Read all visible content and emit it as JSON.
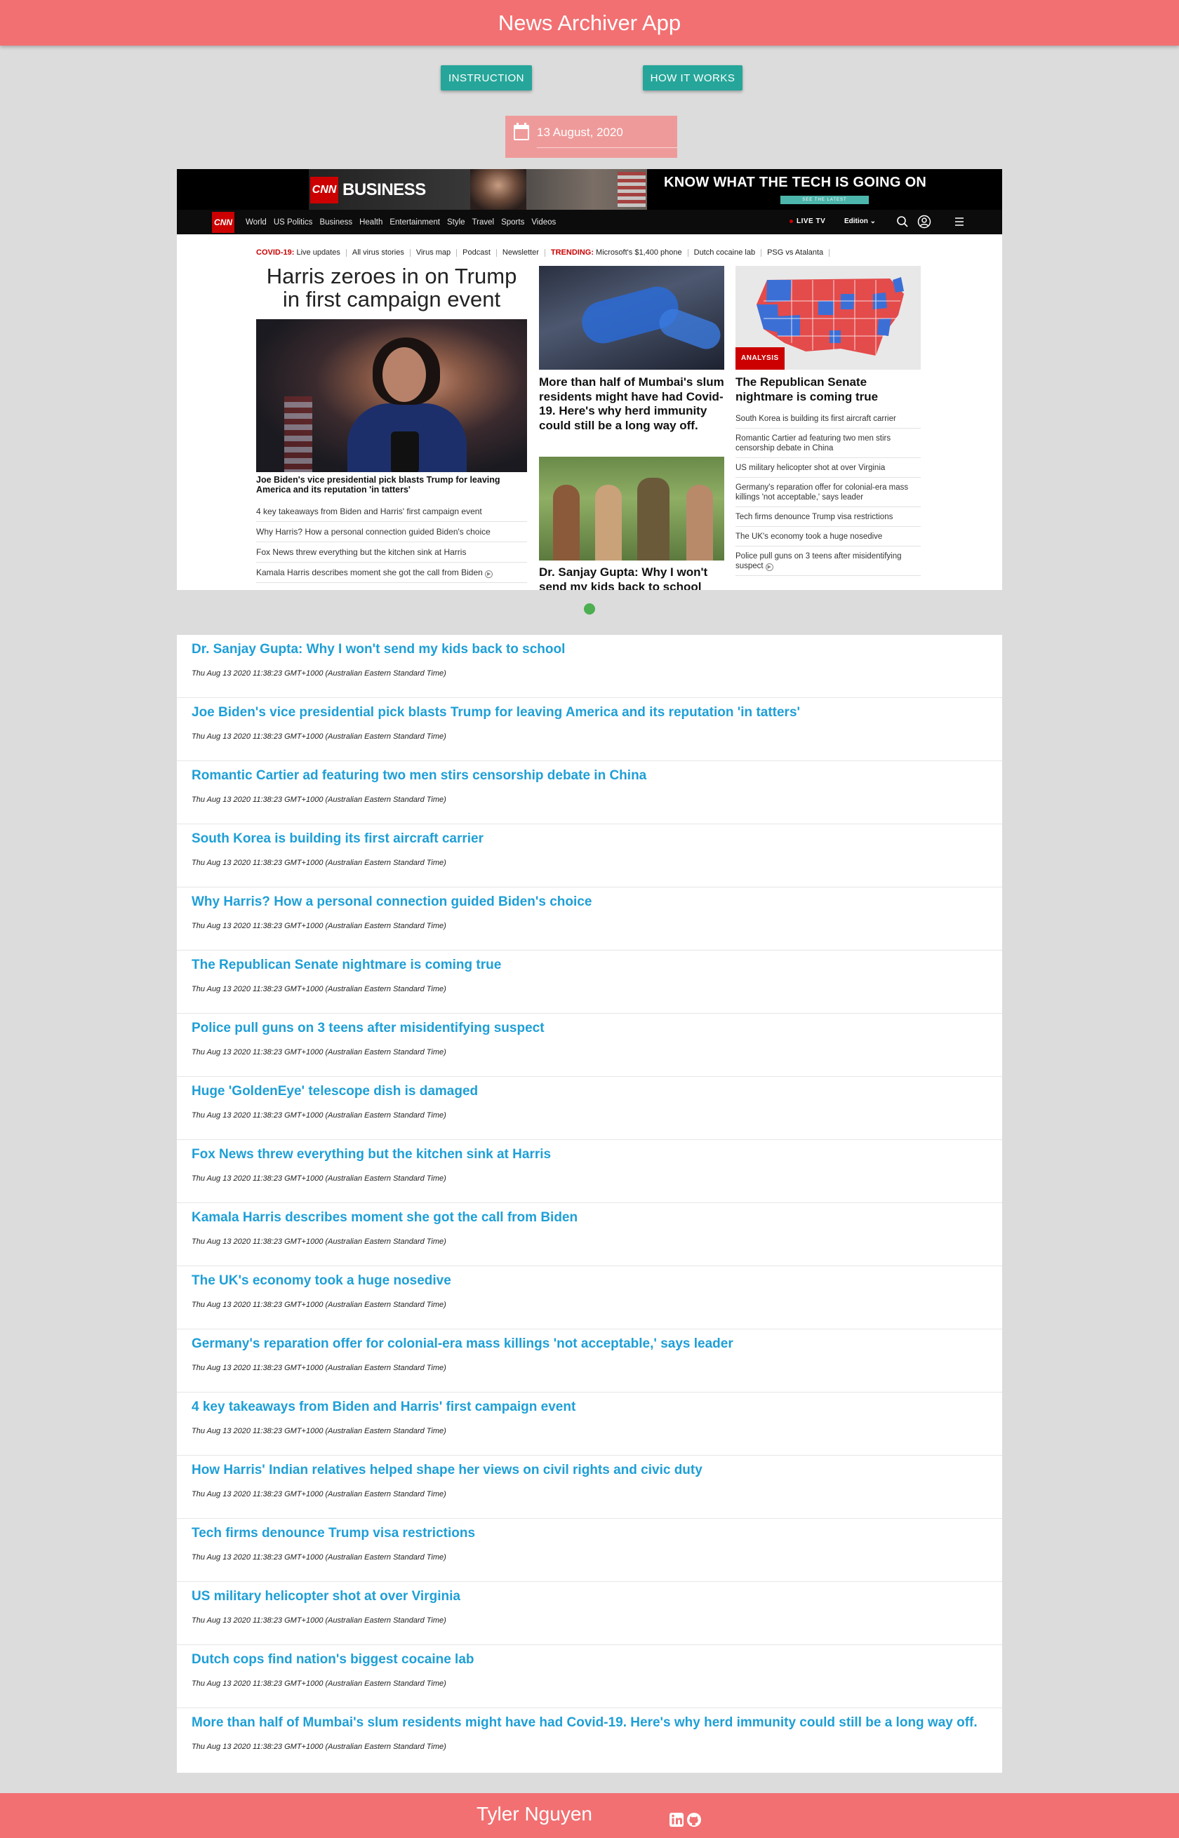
{
  "header": {
    "title": "News Archiver App"
  },
  "buttons": {
    "instruction": "INSTRUCTION",
    "how_it_works": "HOW IT WORKS"
  },
  "date_picker": {
    "value": "13 August, 2020",
    "icon": "calendar-icon"
  },
  "snapshot": {
    "ad": {
      "brand": "CNN",
      "brand_section": "BUSINESS",
      "headline": "KNOW WHAT THE TECH IS GOING ON",
      "cta": "SEE THE LATEST"
    },
    "nav": {
      "logo": "CNN",
      "items": [
        "World",
        "US Politics",
        "Business",
        "Health",
        "Entertainment",
        "Style",
        "Travel",
        "Sports",
        "Videos"
      ],
      "live_tv": "LIVE TV",
      "edition": "Edition"
    },
    "trending": {
      "covid_label": "COVID-19:",
      "covid_items": [
        "Live updates",
        "All virus stories",
        "Virus map",
        "Podcast",
        "Newsletter"
      ],
      "trending_label": "TRENDING:",
      "trending_items": [
        "Microsoft's $1,400 phone",
        "Dutch cocaine lab",
        "PSG vs Atalanta"
      ]
    },
    "lead": {
      "title": "Harris zeroes in on Trump in first campaign event",
      "caption": "Joe Biden's vice presidential pick blasts Trump for leaving America and its reputation 'in tatters'",
      "links": [
        "4 key takeaways from Biden and Harris' first campaign event",
        "Why Harris? How a personal connection guided Biden's choice",
        "Fox News threw everything but the kitchen sink at Harris",
        "Kamala Harris describes moment she got the call from Biden"
      ]
    },
    "middle": {
      "story1": "More than half of Mumbai's slum residents might have had Covid-19. Here's why herd immunity could still be a long way off.",
      "story2": "Dr. Sanjay Gupta: Why I won't send my kids back to school"
    },
    "right": {
      "badge": "ANALYSIS",
      "title": "The Republican Senate nightmare is coming true",
      "links": [
        "South Korea is building its first aircraft carrier",
        "Romantic Cartier ad featuring two men stirs censorship debate in China",
        "US military helicopter shot at over Virginia",
        "Germany's reparation offer for colonial-era mass killings 'not acceptable,' says leader",
        "Tech firms denounce Trump visa restrictions",
        "The UK's economy took a huge nosedive",
        "Police pull guns on 3 teens after misidentifying suspect"
      ]
    }
  },
  "articles": [
    {
      "title": "Dr. Sanjay Gupta: Why I won't send my kids back to school",
      "time": "Thu Aug 13 2020 11:38:23 GMT+1000 (Australian Eastern Standard Time)"
    },
    {
      "title": "Joe Biden's vice presidential pick blasts Trump for leaving America and its reputation 'in tatters'",
      "time": "Thu Aug 13 2020 11:38:23 GMT+1000 (Australian Eastern Standard Time)"
    },
    {
      "title": "Romantic Cartier ad featuring two men stirs censorship debate in China",
      "time": "Thu Aug 13 2020 11:38:23 GMT+1000 (Australian Eastern Standard Time)"
    },
    {
      "title": "South Korea is building its first aircraft carrier",
      "time": "Thu Aug 13 2020 11:38:23 GMT+1000 (Australian Eastern Standard Time)"
    },
    {
      "title": "Why Harris? How a personal connection guided Biden's choice",
      "time": "Thu Aug 13 2020 11:38:23 GMT+1000 (Australian Eastern Standard Time)"
    },
    {
      "title": "The Republican Senate nightmare is coming true",
      "time": "Thu Aug 13 2020 11:38:23 GMT+1000 (Australian Eastern Standard Time)"
    },
    {
      "title": "Police pull guns on 3 teens after misidentifying suspect",
      "time": "Thu Aug 13 2020 11:38:23 GMT+1000 (Australian Eastern Standard Time)"
    },
    {
      "title": "Huge 'GoldenEye' telescope dish is damaged",
      "time": "Thu Aug 13 2020 11:38:23 GMT+1000 (Australian Eastern Standard Time)"
    },
    {
      "title": "Fox News threw everything but the kitchen sink at Harris",
      "time": "Thu Aug 13 2020 11:38:23 GMT+1000 (Australian Eastern Standard Time)"
    },
    {
      "title": "Kamala Harris describes moment she got the call from Biden",
      "time": "Thu Aug 13 2020 11:38:23 GMT+1000 (Australian Eastern Standard Time)"
    },
    {
      "title": "The UK's economy took a huge nosedive",
      "time": "Thu Aug 13 2020 11:38:23 GMT+1000 (Australian Eastern Standard Time)"
    },
    {
      "title": "Germany's reparation offer for colonial-era mass killings 'not acceptable,' says leader",
      "time": "Thu Aug 13 2020 11:38:23 GMT+1000 (Australian Eastern Standard Time)"
    },
    {
      "title": "4 key takeaways from Biden and Harris' first campaign event",
      "time": "Thu Aug 13 2020 11:38:23 GMT+1000 (Australian Eastern Standard Time)"
    },
    {
      "title": "How Harris' Indian relatives helped shape her views on civil rights and civic duty",
      "time": "Thu Aug 13 2020 11:38:23 GMT+1000 (Australian Eastern Standard Time)"
    },
    {
      "title": "Tech firms denounce Trump visa restrictions",
      "time": "Thu Aug 13 2020 11:38:23 GMT+1000 (Australian Eastern Standard Time)"
    },
    {
      "title": "US military helicopter shot at over Virginia",
      "time": "Thu Aug 13 2020 11:38:23 GMT+1000 (Australian Eastern Standard Time)"
    },
    {
      "title": "Dutch cops find nation's biggest cocaine lab",
      "time": "Thu Aug 13 2020 11:38:23 GMT+1000 (Australian Eastern Standard Time)"
    },
    {
      "title": "More than half of Mumbai's slum residents might have had Covid-19. Here's why herd immunity could still be a long way off.",
      "time": "Thu Aug 13 2020 11:38:23 GMT+1000 (Australian Eastern Standard Time)"
    }
  ],
  "footer": {
    "name": "Tyler Nguyen",
    "icons": [
      "linkedin-icon",
      "github-icon"
    ]
  },
  "colors": {
    "header_bg": "#f27072",
    "button_bg": "#26a69a",
    "date_bg": "#ef9a9a",
    "link_blue": "#1e9fd6",
    "carousel_dot": "#4caf50",
    "cnn_red": "#cc0000"
  }
}
